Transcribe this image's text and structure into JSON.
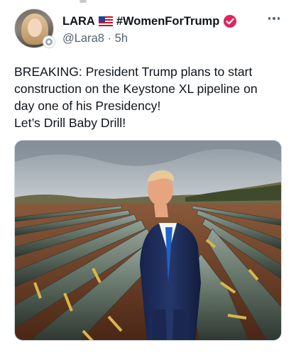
{
  "author": {
    "display_name": "LARA",
    "hashtag": "#WomenForTrump",
    "handle": "@Lara8",
    "separator": "·",
    "time_ago": "5h",
    "flag_icon": "us-flag-icon",
    "verified_icon": "verified-badge-icon",
    "verified_color": "#e0245e"
  },
  "more_icon": "more-options-icon",
  "tweet": {
    "lines": [
      "BREAKING: President Trump plans to start",
      "construction on the Keystone XL pipeline on",
      "day one of his Presidency!",
      "Let’s Drill Baby Drill!"
    ]
  },
  "media": {
    "description_icon": "photo-pipeline-man-suit",
    "sky_color": "#b9c2c8",
    "soil_color": "#6b3a24",
    "pipe_color": "#5f6e63",
    "band_color": "#d8b64a",
    "suit_color": "#1f2f5c",
    "tie_color": "#1e63c8"
  }
}
